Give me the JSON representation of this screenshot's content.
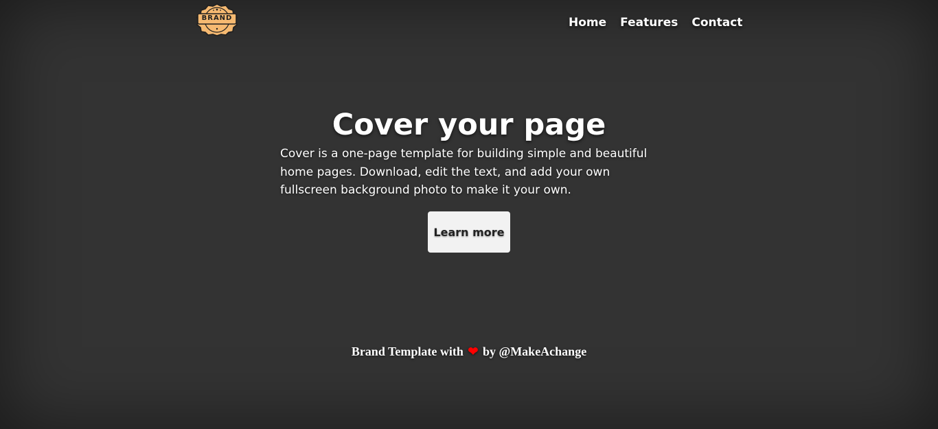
{
  "header": {
    "logo": {
      "text": "BRAND",
      "icon": "brand-badge-icon",
      "badge_color": "#f5b971",
      "outline_color": "#1f1f1f"
    },
    "nav": [
      {
        "label": "Home"
      },
      {
        "label": "Features"
      },
      {
        "label": "Contact"
      }
    ]
  },
  "hero": {
    "title": "Cover your page",
    "lead": "Cover is a one-page template for building simple and beautiful home pages. Download, edit the text, and add your own fullscreen background photo to make it your own.",
    "button_label": "Learn more"
  },
  "footer": {
    "text_before": "Brand Template with",
    "heart_icon": "heart-icon",
    "heart_glyph": "❤",
    "heart_color": "#ff0000",
    "text_after": "by @MakeAchange"
  },
  "colors": {
    "background": "#333333",
    "text": "#ffffff",
    "button_bg": "#f2f2f2",
    "button_text": "#222222"
  }
}
